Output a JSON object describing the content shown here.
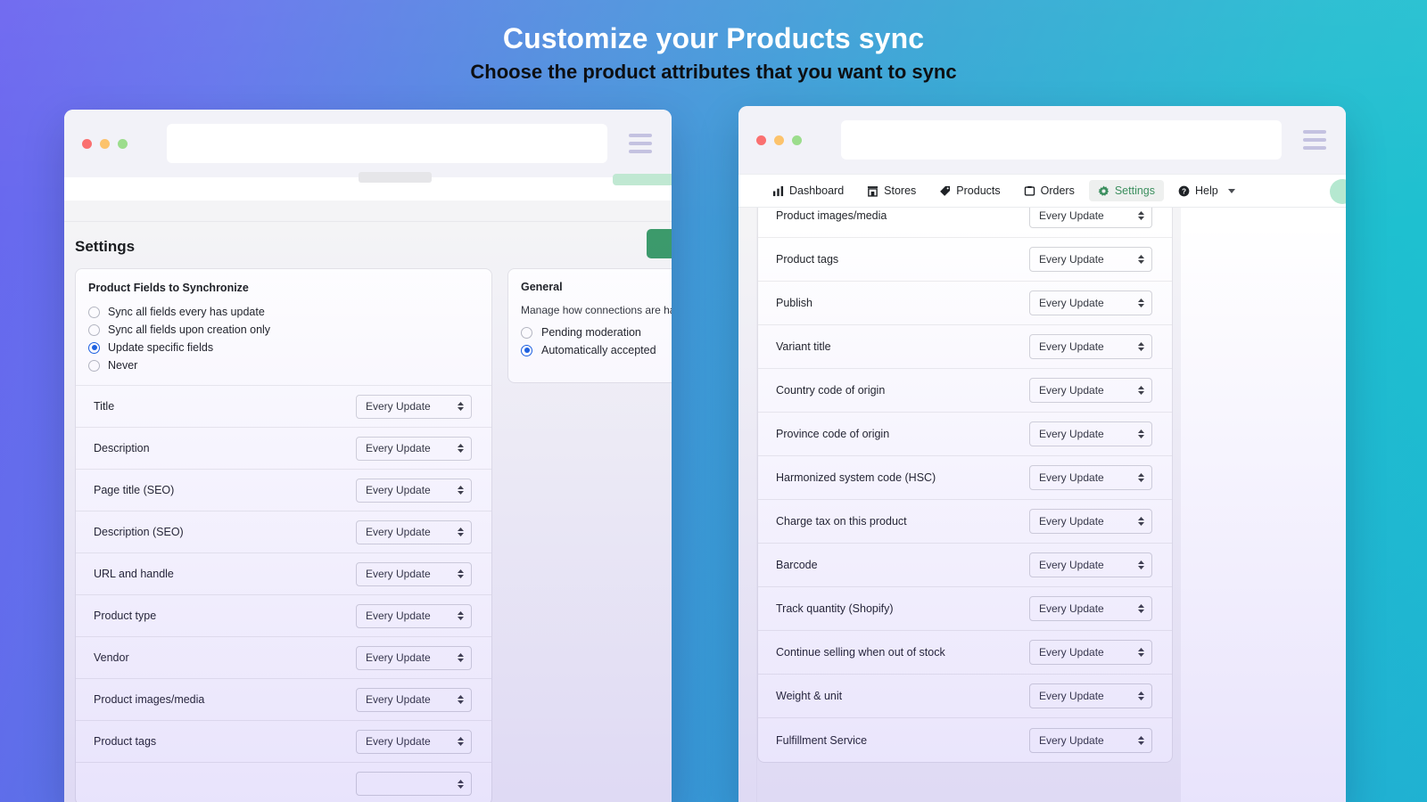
{
  "headings": {
    "title": "Customize your Products sync",
    "subtitle": "Choose the product attributes that you want to sync"
  },
  "colors": {
    "gradient_start": "#6a63ef",
    "gradient_end": "#18c6cf",
    "accent_green": "#3c8f5f",
    "radio_selected": "#1d63e0",
    "dot_red": "#fa6d6d",
    "dot_yellow": "#fcc269",
    "dot_green": "#9adc8a"
  },
  "left_window": {
    "chrome": {
      "url_value": "",
      "url_placeholder": "",
      "menu_icon": "hamburger-icon"
    },
    "page_title": "Settings",
    "fields_card": {
      "title": "Product Fields to Synchronize",
      "options": [
        {
          "label": "Sync all fields every has update",
          "selected": false
        },
        {
          "label": "Sync all fields upon creation only",
          "selected": false
        },
        {
          "label": "Update specific fields",
          "selected": true
        },
        {
          "label": "Never",
          "selected": false
        }
      ],
      "rows": [
        {
          "label": "Title",
          "value": "Every Update"
        },
        {
          "label": "Description",
          "value": "Every Update"
        },
        {
          "label": "Page title (SEO)",
          "value": "Every Update"
        },
        {
          "label": "Description (SEO)",
          "value": "Every Update"
        },
        {
          "label": "URL and handle",
          "value": "Every Update"
        },
        {
          "label": "Product type",
          "value": "Every Update"
        },
        {
          "label": "Vendor",
          "value": "Every Update"
        },
        {
          "label": "Product images/media",
          "value": "Every Update"
        },
        {
          "label": "Product tags",
          "value": "Every Update"
        },
        {
          "label": "",
          "value": ""
        }
      ]
    },
    "general_card": {
      "title": "General",
      "description": "Manage how connections are handled for this store.",
      "options": [
        {
          "label": "Pending moderation",
          "selected": false
        },
        {
          "label": "Automatically accepted",
          "selected": true
        }
      ]
    }
  },
  "right_window": {
    "chrome": {
      "url_value": "",
      "url_placeholder": "",
      "menu_icon": "hamburger-icon"
    },
    "nav": [
      {
        "label": "Dashboard",
        "icon": "bar-chart-icon",
        "active": false
      },
      {
        "label": "Stores",
        "icon": "store-icon",
        "active": false
      },
      {
        "label": "Products",
        "icon": "tag-icon",
        "active": false
      },
      {
        "label": "Orders",
        "icon": "box-icon",
        "active": false
      },
      {
        "label": "Settings",
        "icon": "gear-icon",
        "active": true
      },
      {
        "label": "Help",
        "icon": "question-circle-icon",
        "active": false,
        "has_caret": true
      }
    ],
    "rows": [
      {
        "label": "Product images/media",
        "value": "Every Update"
      },
      {
        "label": "Product tags",
        "value": "Every Update"
      },
      {
        "label": "Publish",
        "value": "Every Update"
      },
      {
        "label": "Variant title",
        "value": "Every Update"
      },
      {
        "label": "Country code of origin",
        "value": "Every Update"
      },
      {
        "label": "Province code of origin",
        "value": "Every Update"
      },
      {
        "label": "Harmonized system code (HSC)",
        "value": "Every Update"
      },
      {
        "label": "Charge tax on this product",
        "value": "Every Update"
      },
      {
        "label": "Barcode",
        "value": "Every Update"
      },
      {
        "label": "Track quantity (Shopify)",
        "value": "Every Update"
      },
      {
        "label": "Continue selling when out of stock",
        "value": "Every Update"
      },
      {
        "label": "Weight & unit",
        "value": "Every Update"
      },
      {
        "label": "Fulfillment Service",
        "value": "Every Update"
      }
    ]
  }
}
